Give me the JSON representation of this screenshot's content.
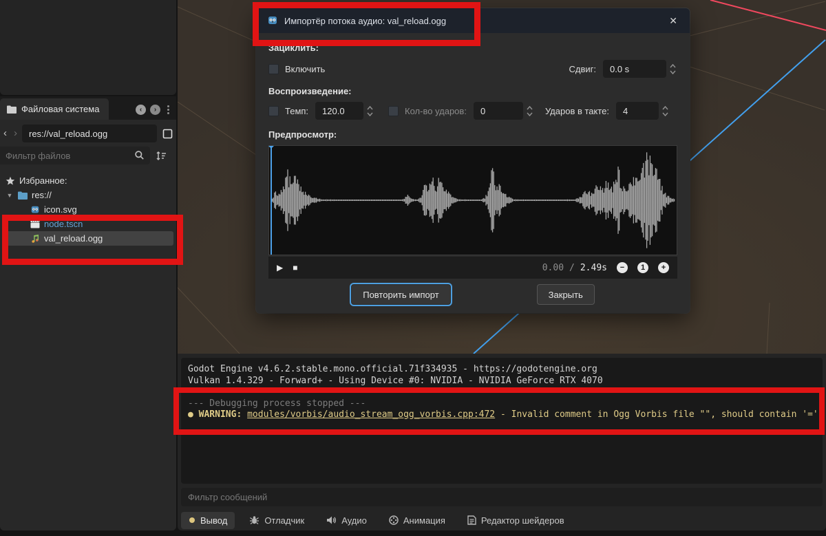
{
  "filesystem_dock": {
    "tab_label": "Файловая система",
    "path_value": "res://val_reload.ogg",
    "filter_placeholder": "Фильтр файлов",
    "tree": [
      {
        "label": "Избранное:",
        "icon": "star",
        "indent": 0,
        "twisty": false,
        "selected": false,
        "blue": false
      },
      {
        "label": "res://",
        "icon": "folder",
        "indent": 0,
        "twisty": true,
        "selected": false,
        "blue": false
      },
      {
        "label": "icon.svg",
        "icon": "godot",
        "indent": 1,
        "twisty": false,
        "selected": false,
        "blue": false
      },
      {
        "label": "node.tscn",
        "icon": "scene",
        "indent": 1,
        "twisty": false,
        "selected": false,
        "blue": true
      },
      {
        "label": "val_reload.ogg",
        "icon": "audio",
        "indent": 1,
        "twisty": false,
        "selected": true,
        "blue": false
      }
    ]
  },
  "dialog": {
    "title": "Импортёр потока аудио: val_reload.ogg",
    "close_glyph": "✕",
    "section_loop": "Зациклить:",
    "section_playback": "Воспроизведение:",
    "section_preview": "Предпросмотр:",
    "enable_label": "Включить",
    "offset_label": "Сдвиг:",
    "offset_value": "0.0 s",
    "tempo_label": "Темп:",
    "tempo_value": "120.0",
    "beat_count_label": "Кол-во ударов:",
    "beat_count_value": "0",
    "bar_beats_label": "Ударов в такте:",
    "bar_beats_value": "4",
    "play_glyph": "▶",
    "stop_glyph": "■",
    "time_current": "0.00",
    "time_sep": "/",
    "time_total": "2.49s",
    "zoom_out_glyph": "−",
    "zoom_reset_glyph": "1",
    "zoom_in_glyph": "+",
    "reimport_button": "Повторить импорт",
    "close_button": "Закрыть"
  },
  "console": {
    "lines": [
      {
        "type": "plain",
        "text": "Godot Engine v4.6.2.stable.mono.official.71f334935 - https://godotengine.org"
      },
      {
        "type": "plain",
        "text": "Vulkan 1.4.329 - Forward+ - Using Device #0: NVIDIA - NVIDIA GeForce RTX 4070"
      },
      {
        "type": "spacer"
      },
      {
        "type": "muted",
        "text": "--- Debugging process stopped ---"
      },
      {
        "type": "warning",
        "bullet": "●",
        "label": "WARNING:",
        "link": "modules/vorbis/audio_stream_ogg_vorbis.cpp:472",
        "rest": " - Invalid comment in Ogg Vorbis file \"\", should contain '=': \"\"."
      }
    ],
    "filter_placeholder": "Фильтр сообщений",
    "tabs": [
      {
        "label": "Вывод",
        "icon": "dot",
        "active": true
      },
      {
        "label": "Отладчик",
        "icon": "bug",
        "active": false
      },
      {
        "label": "Аудио",
        "icon": "speaker",
        "active": false
      },
      {
        "label": "Анимация",
        "icon": "film",
        "active": false
      },
      {
        "label": "Редактор шейдеров",
        "icon": "shader-doc",
        "active": false
      }
    ]
  },
  "icons": {
    "star": "★ favorites",
    "folder": "blue folder",
    "godot": "godot robot head",
    "scene": "scene clapperboard",
    "audio": "music note",
    "dot": "yellow status dot",
    "bug": "debugger bug",
    "speaker": "audio speaker",
    "film": "animation film reel",
    "shader-doc": "shader document"
  },
  "colors": {
    "annotation_red": "#e11414",
    "axis_x_red": "#f0485e",
    "axis_z_blue": "#42a0ee",
    "warning_yellow": "#e0cc88",
    "focus_blue": "#4d9fe0",
    "scene_file_blue": "#64a3d6",
    "viewport_brown": "#39322b"
  },
  "waveform": {
    "playhead_color": "#4da2ea",
    "bar_color": "#a9a9a9",
    "envelope": [
      [
        0.0,
        0.02
      ],
      [
        0.008,
        0.06
      ],
      [
        0.015,
        0.2
      ],
      [
        0.025,
        0.14
      ],
      [
        0.035,
        0.3
      ],
      [
        0.045,
        0.62
      ],
      [
        0.055,
        0.38
      ],
      [
        0.065,
        0.55
      ],
      [
        0.075,
        0.3
      ],
      [
        0.085,
        0.22
      ],
      [
        0.095,
        0.12
      ],
      [
        0.11,
        0.06
      ],
      [
        0.13,
        0.02
      ],
      [
        0.2,
        0.01
      ],
      [
        0.32,
        0.01
      ],
      [
        0.33,
        0.03
      ],
      [
        0.34,
        0.13
      ],
      [
        0.35,
        0.03
      ],
      [
        0.365,
        0.02
      ],
      [
        0.375,
        0.1
      ],
      [
        0.385,
        0.48
      ],
      [
        0.392,
        0.3
      ],
      [
        0.4,
        0.56
      ],
      [
        0.41,
        0.32
      ],
      [
        0.418,
        0.5
      ],
      [
        0.428,
        0.36
      ],
      [
        0.438,
        0.2
      ],
      [
        0.45,
        0.08
      ],
      [
        0.465,
        0.02
      ],
      [
        0.52,
        0.01
      ],
      [
        0.53,
        0.06
      ],
      [
        0.54,
        0.28
      ],
      [
        0.548,
        0.92
      ],
      [
        0.556,
        0.4
      ],
      [
        0.565,
        0.42
      ],
      [
        0.575,
        0.22
      ],
      [
        0.588,
        0.08
      ],
      [
        0.6,
        0.02
      ],
      [
        0.7,
        0.01
      ],
      [
        0.75,
        0.02
      ],
      [
        0.765,
        0.1
      ],
      [
        0.78,
        0.24
      ],
      [
        0.793,
        0.16
      ],
      [
        0.805,
        0.36
      ],
      [
        0.818,
        0.26
      ],
      [
        0.83,
        0.44
      ],
      [
        0.842,
        0.3
      ],
      [
        0.855,
        0.78
      ],
      [
        0.865,
        0.38
      ],
      [
        0.875,
        0.32
      ],
      [
        0.885,
        0.46
      ],
      [
        0.897,
        0.58
      ],
      [
        0.908,
        0.8
      ],
      [
        0.92,
        0.97
      ],
      [
        0.932,
        0.99
      ],
      [
        0.944,
        0.88
      ],
      [
        0.955,
        0.52
      ],
      [
        0.965,
        0.28
      ],
      [
        0.975,
        0.12
      ],
      [
        0.988,
        0.05
      ],
      [
        1.0,
        0.02
      ]
    ]
  }
}
